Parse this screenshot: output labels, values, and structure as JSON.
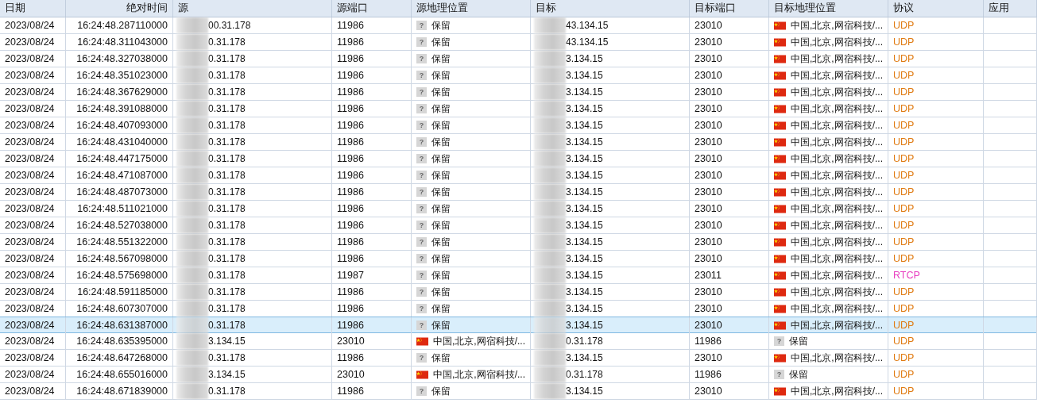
{
  "table": {
    "columns": [
      {
        "label": "日期"
      },
      {
        "label": "绝对时间"
      },
      {
        "label": "源"
      },
      {
        "label": "源端口"
      },
      {
        "label": "源地理位置"
      },
      {
        "label": "目标"
      },
      {
        "label": "目标端口"
      },
      {
        "label": "目标地理位置"
      },
      {
        "label": "协议"
      },
      {
        "label": "应用"
      }
    ],
    "rows": [
      {
        "selected": false,
        "date": "2023/08/24",
        "time": "16:24:48.287110000",
        "src": "00.31.178",
        "src_port": "11986",
        "src_geo": {
          "kind": "unknown",
          "badge": "?",
          "text": "保留"
        },
        "dst": "43.134.15",
        "dst_port": "23010",
        "dst_geo": {
          "kind": "cn",
          "text": "中国,北京,网宿科技/..."
        },
        "protocol": {
          "text": "UDP",
          "color": "#e07b12"
        }
      },
      {
        "selected": false,
        "date": "2023/08/24",
        "time": "16:24:48.311043000",
        "src": "0.31.178",
        "src_port": "11986",
        "src_geo": {
          "kind": "unknown",
          "badge": "?",
          "text": "保留"
        },
        "dst": "43.134.15",
        "dst_port": "23010",
        "dst_geo": {
          "kind": "cn",
          "text": "中国,北京,网宿科技/..."
        },
        "protocol": {
          "text": "UDP",
          "color": "#e07b12"
        }
      },
      {
        "selected": false,
        "date": "2023/08/24",
        "time": "16:24:48.327038000",
        "src": "0.31.178",
        "src_port": "11986",
        "src_geo": {
          "kind": "unknown",
          "badge": "?",
          "text": "保留"
        },
        "dst": "3.134.15",
        "dst_port": "23010",
        "dst_geo": {
          "kind": "cn",
          "text": "中国,北京,网宿科技/..."
        },
        "protocol": {
          "text": "UDP",
          "color": "#e07b12"
        }
      },
      {
        "selected": false,
        "date": "2023/08/24",
        "time": "16:24:48.351023000",
        "src": "0.31.178",
        "src_port": "11986",
        "src_geo": {
          "kind": "unknown",
          "badge": "?",
          "text": "保留"
        },
        "dst": "3.134.15",
        "dst_port": "23010",
        "dst_geo": {
          "kind": "cn",
          "text": "中国,北京,网宿科技/..."
        },
        "protocol": {
          "text": "UDP",
          "color": "#e07b12"
        }
      },
      {
        "selected": false,
        "date": "2023/08/24",
        "time": "16:24:48.367629000",
        "src": "0.31.178",
        "src_port": "11986",
        "src_geo": {
          "kind": "unknown",
          "badge": "?",
          "text": "保留"
        },
        "dst": "3.134.15",
        "dst_port": "23010",
        "dst_geo": {
          "kind": "cn",
          "text": "中国,北京,网宿科技/..."
        },
        "protocol": {
          "text": "UDP",
          "color": "#e07b12"
        }
      },
      {
        "selected": false,
        "date": "2023/08/24",
        "time": "16:24:48.391088000",
        "src": "0.31.178",
        "src_port": "11986",
        "src_geo": {
          "kind": "unknown",
          "badge": "?",
          "text": "保留"
        },
        "dst": "3.134.15",
        "dst_port": "23010",
        "dst_geo": {
          "kind": "cn",
          "text": "中国,北京,网宿科技/..."
        },
        "protocol": {
          "text": "UDP",
          "color": "#e07b12"
        }
      },
      {
        "selected": false,
        "date": "2023/08/24",
        "time": "16:24:48.407093000",
        "src": "0.31.178",
        "src_port": "11986",
        "src_geo": {
          "kind": "unknown",
          "badge": "?",
          "text": "保留"
        },
        "dst": "3.134.15",
        "dst_port": "23010",
        "dst_geo": {
          "kind": "cn",
          "text": "中国,北京,网宿科技/..."
        },
        "protocol": {
          "text": "UDP",
          "color": "#e07b12"
        }
      },
      {
        "selected": false,
        "date": "2023/08/24",
        "time": "16:24:48.431040000",
        "src": "0.31.178",
        "src_port": "11986",
        "src_geo": {
          "kind": "unknown",
          "badge": "?",
          "text": "保留"
        },
        "dst": "3.134.15",
        "dst_port": "23010",
        "dst_geo": {
          "kind": "cn",
          "text": "中国,北京,网宿科技/..."
        },
        "protocol": {
          "text": "UDP",
          "color": "#e07b12"
        }
      },
      {
        "selected": false,
        "date": "2023/08/24",
        "time": "16:24:48.447175000",
        "src": "0.31.178",
        "src_port": "11986",
        "src_geo": {
          "kind": "unknown",
          "badge": "?",
          "text": "保留"
        },
        "dst": "3.134.15",
        "dst_port": "23010",
        "dst_geo": {
          "kind": "cn",
          "text": "中国,北京,网宿科技/..."
        },
        "protocol": {
          "text": "UDP",
          "color": "#e07b12"
        }
      },
      {
        "selected": false,
        "date": "2023/08/24",
        "time": "16:24:48.471087000",
        "src": "0.31.178",
        "src_port": "11986",
        "src_geo": {
          "kind": "unknown",
          "badge": "?",
          "text": "保留"
        },
        "dst": "3.134.15",
        "dst_port": "23010",
        "dst_geo": {
          "kind": "cn",
          "text": "中国,北京,网宿科技/..."
        },
        "protocol": {
          "text": "UDP",
          "color": "#e07b12"
        }
      },
      {
        "selected": false,
        "date": "2023/08/24",
        "time": "16:24:48.487073000",
        "src": "0.31.178",
        "src_port": "11986",
        "src_geo": {
          "kind": "unknown",
          "badge": "?",
          "text": "保留"
        },
        "dst": "3.134.15",
        "dst_port": "23010",
        "dst_geo": {
          "kind": "cn",
          "text": "中国,北京,网宿科技/..."
        },
        "protocol": {
          "text": "UDP",
          "color": "#e07b12"
        }
      },
      {
        "selected": false,
        "date": "2023/08/24",
        "time": "16:24:48.511021000",
        "src": "0.31.178",
        "src_port": "11986",
        "src_geo": {
          "kind": "unknown",
          "badge": "?",
          "text": "保留"
        },
        "dst": "3.134.15",
        "dst_port": "23010",
        "dst_geo": {
          "kind": "cn",
          "text": "中国,北京,网宿科技/..."
        },
        "protocol": {
          "text": "UDP",
          "color": "#e07b12"
        }
      },
      {
        "selected": false,
        "date": "2023/08/24",
        "time": "16:24:48.527038000",
        "src": "0.31.178",
        "src_port": "11986",
        "src_geo": {
          "kind": "unknown",
          "badge": "?",
          "text": "保留"
        },
        "dst": "3.134.15",
        "dst_port": "23010",
        "dst_geo": {
          "kind": "cn",
          "text": "中国,北京,网宿科技/..."
        },
        "protocol": {
          "text": "UDP",
          "color": "#e07b12"
        }
      },
      {
        "selected": false,
        "date": "2023/08/24",
        "time": "16:24:48.551322000",
        "src": "0.31.178",
        "src_port": "11986",
        "src_geo": {
          "kind": "unknown",
          "badge": "?",
          "text": "保留"
        },
        "dst": "3.134.15",
        "dst_port": "23010",
        "dst_geo": {
          "kind": "cn",
          "text": "中国,北京,网宿科技/..."
        },
        "protocol": {
          "text": "UDP",
          "color": "#e07b12"
        }
      },
      {
        "selected": false,
        "date": "2023/08/24",
        "time": "16:24:48.567098000",
        "src": "0.31.178",
        "src_port": "11986",
        "src_geo": {
          "kind": "unknown",
          "badge": "?",
          "text": "保留"
        },
        "dst": "3.134.15",
        "dst_port": "23010",
        "dst_geo": {
          "kind": "cn",
          "text": "中国,北京,网宿科技/..."
        },
        "protocol": {
          "text": "UDP",
          "color": "#e07b12"
        }
      },
      {
        "selected": false,
        "date": "2023/08/24",
        "time": "16:24:48.575698000",
        "src": "0.31.178",
        "src_port": "11987",
        "src_geo": {
          "kind": "unknown",
          "badge": "?",
          "text": "保留"
        },
        "dst": "3.134.15",
        "dst_port": "23011",
        "dst_geo": {
          "kind": "cn",
          "text": "中国,北京,网宿科技/..."
        },
        "protocol": {
          "text": "RTCP",
          "color": "#e83fc0"
        }
      },
      {
        "selected": false,
        "date": "2023/08/24",
        "time": "16:24:48.591185000",
        "src": "0.31.178",
        "src_port": "11986",
        "src_geo": {
          "kind": "unknown",
          "badge": "?",
          "text": "保留"
        },
        "dst": "3.134.15",
        "dst_port": "23010",
        "dst_geo": {
          "kind": "cn",
          "text": "中国,北京,网宿科技/..."
        },
        "protocol": {
          "text": "UDP",
          "color": "#e07b12"
        }
      },
      {
        "selected": false,
        "date": "2023/08/24",
        "time": "16:24:48.607307000",
        "src": "0.31.178",
        "src_port": "11986",
        "src_geo": {
          "kind": "unknown",
          "badge": "?",
          "text": "保留"
        },
        "dst": "3.134.15",
        "dst_port": "23010",
        "dst_geo": {
          "kind": "cn",
          "text": "中国,北京,网宿科技/..."
        },
        "protocol": {
          "text": "UDP",
          "color": "#e07b12"
        }
      },
      {
        "selected": true,
        "date": "2023/08/24",
        "time": "16:24:48.631387000",
        "src": "0.31.178",
        "src_port": "11986",
        "src_geo": {
          "kind": "unknown",
          "badge": "?",
          "text": "保留"
        },
        "dst": "3.134.15",
        "dst_port": "23010",
        "dst_geo": {
          "kind": "cn",
          "text": "中国,北京,网宿科技/..."
        },
        "protocol": {
          "text": "UDP",
          "color": "#e07b12"
        }
      },
      {
        "selected": false,
        "date": "2023/08/24",
        "time": "16:24:48.635395000",
        "src": "3.134.15",
        "src_port": "23010",
        "src_geo": {
          "kind": "cn",
          "text": "中国,北京,网宿科技/..."
        },
        "dst": "0.31.178",
        "dst_port": "11986",
        "dst_geo": {
          "kind": "unknown",
          "badge": "?",
          "text": "保留"
        },
        "protocol": {
          "text": "UDP",
          "color": "#e07b12"
        }
      },
      {
        "selected": false,
        "date": "2023/08/24",
        "time": "16:24:48.647268000",
        "src": "0.31.178",
        "src_port": "11986",
        "src_geo": {
          "kind": "unknown",
          "badge": "?",
          "text": "保留"
        },
        "dst": "3.134.15",
        "dst_port": "23010",
        "dst_geo": {
          "kind": "cn",
          "text": "中国,北京,网宿科技/..."
        },
        "protocol": {
          "text": "UDP",
          "color": "#e07b12"
        }
      },
      {
        "selected": false,
        "date": "2023/08/24",
        "time": "16:24:48.655016000",
        "src": "3.134.15",
        "src_port": "23010",
        "src_geo": {
          "kind": "cn",
          "text": "中国,北京,网宿科技/..."
        },
        "dst": "0.31.178",
        "dst_port": "11986",
        "dst_geo": {
          "kind": "unknown",
          "badge": "?",
          "text": "保留"
        },
        "protocol": {
          "text": "UDP",
          "color": "#e07b12"
        }
      },
      {
        "selected": false,
        "date": "2023/08/24",
        "time": "16:24:48.671839000",
        "src": "0.31.178",
        "src_port": "11986",
        "src_geo": {
          "kind": "unknown",
          "badge": "?",
          "text": "保留"
        },
        "dst": "3.134.15",
        "dst_port": "23010",
        "dst_geo": {
          "kind": "cn",
          "text": "中国,北京,网宿科技/..."
        },
        "protocol": {
          "text": "UDP",
          "color": "#e07b12"
        }
      }
    ]
  }
}
